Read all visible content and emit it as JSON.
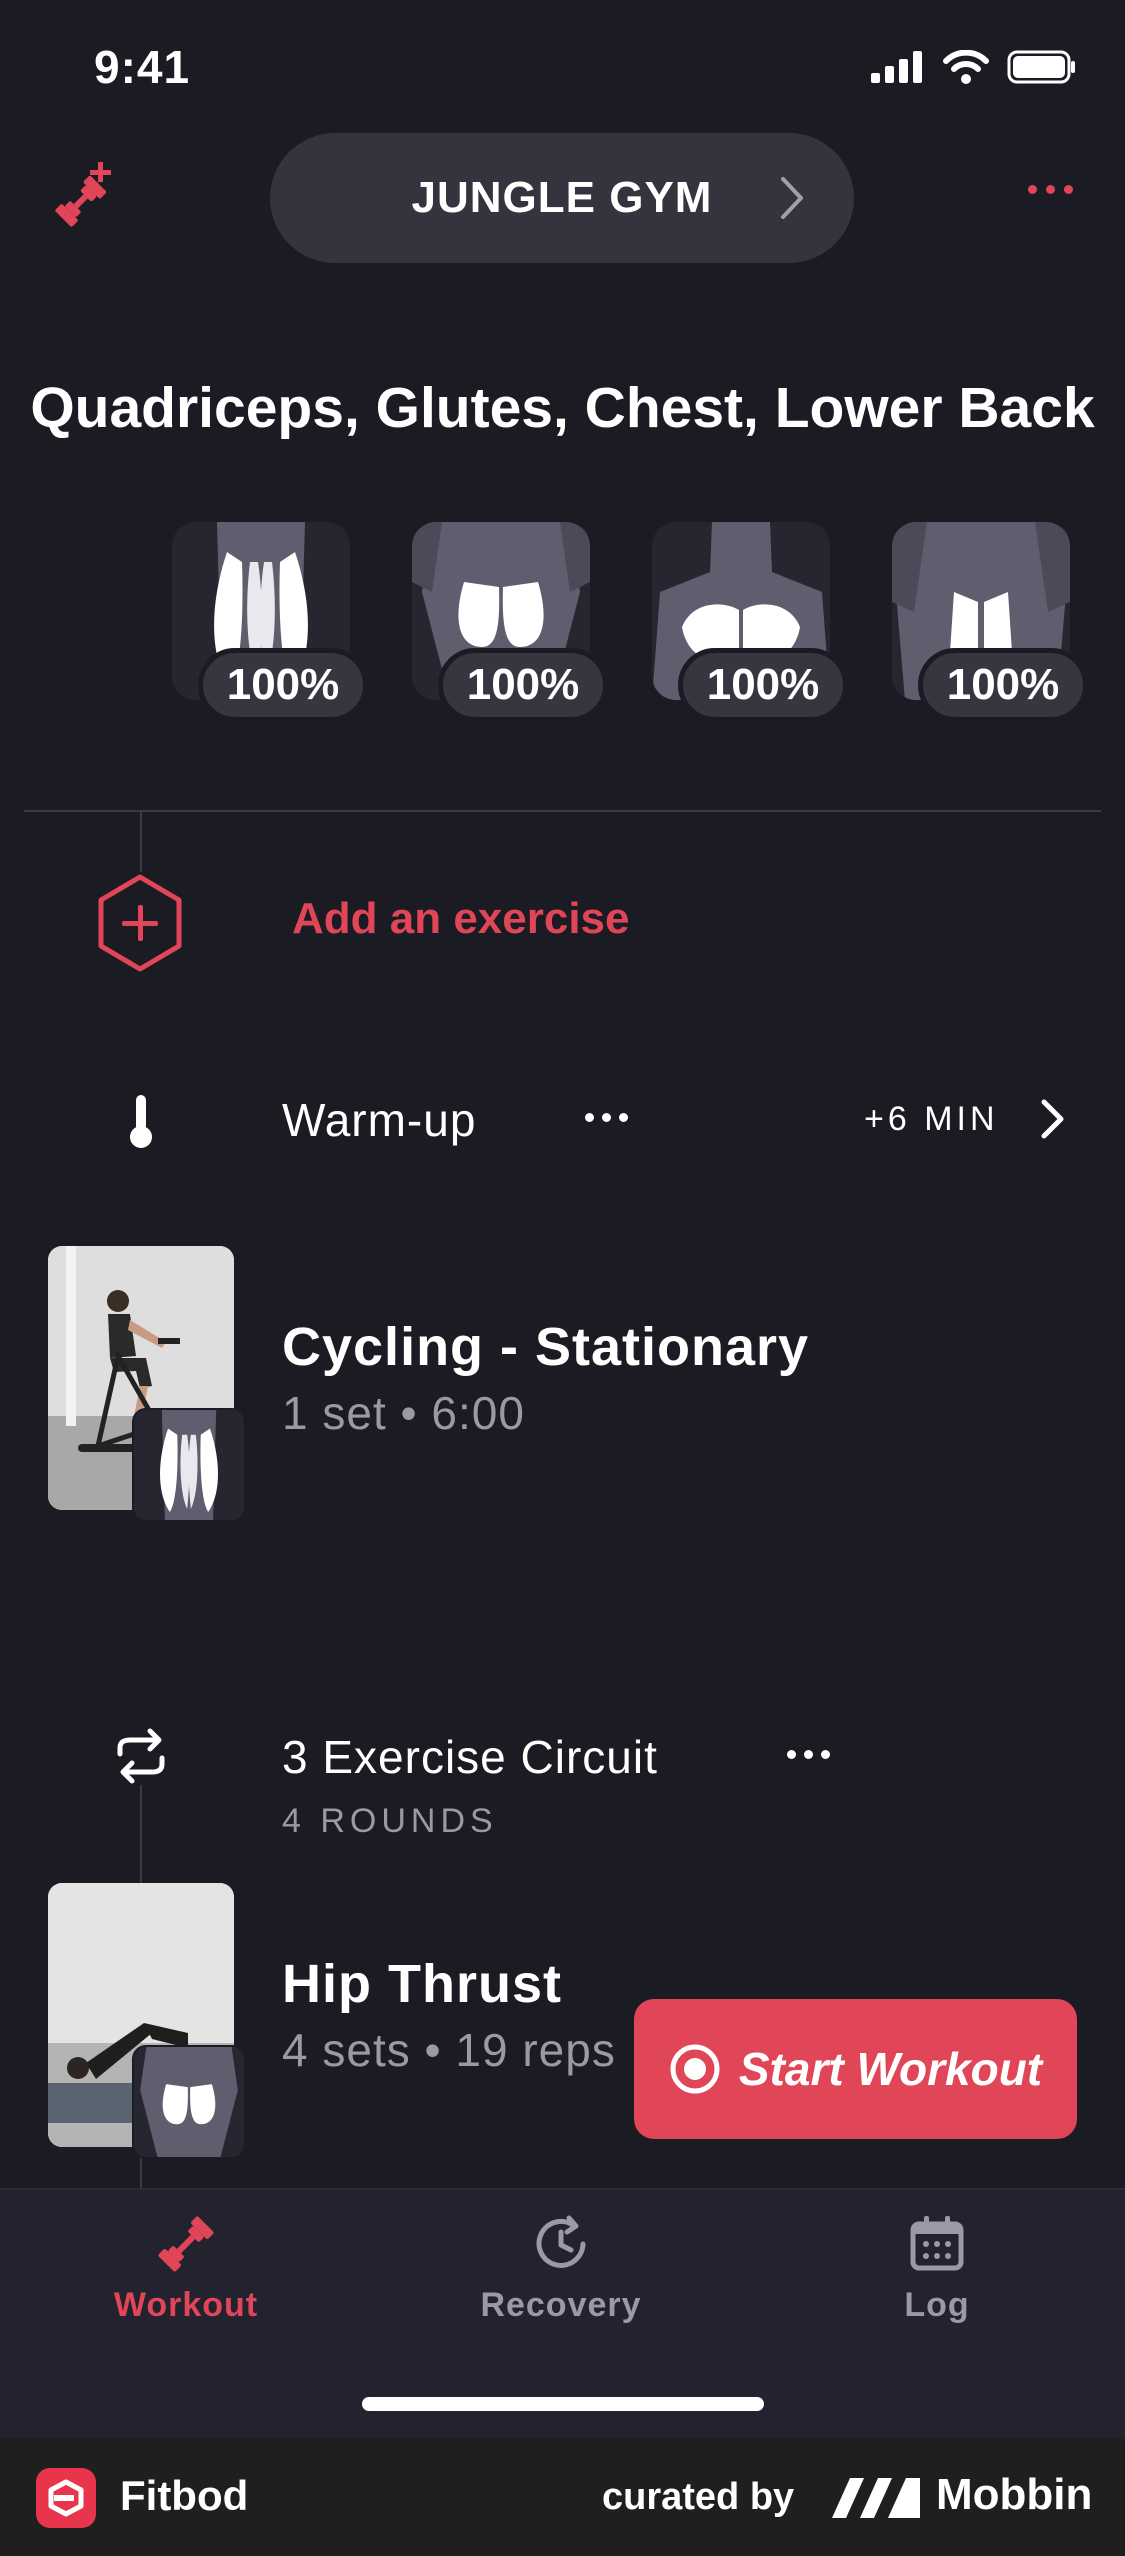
{
  "status": {
    "time": "9:41"
  },
  "header": {
    "gym_name": "JUNGLE GYM"
  },
  "muscles": {
    "title": "Quadriceps, Glutes, Chest, Lower Back",
    "items": [
      {
        "name": "quadriceps",
        "percent": "100%"
      },
      {
        "name": "glutes",
        "percent": "100%"
      },
      {
        "name": "chest",
        "percent": "100%"
      },
      {
        "name": "lower-back",
        "percent": "100%"
      }
    ]
  },
  "add_exercise": {
    "label": "Add an exercise"
  },
  "warmup": {
    "label": "Warm-up",
    "duration": "+6 MIN"
  },
  "exercises": [
    {
      "name": "Cycling - Stationary",
      "detail": "1 set • 6:00"
    },
    {
      "name": "Hip Thrust",
      "detail": "4 sets • 19 reps"
    }
  ],
  "circuit": {
    "label": "3 Exercise Circuit",
    "rounds": "4 ROUNDS"
  },
  "start_button": {
    "label": "Start Workout"
  },
  "tabs": [
    {
      "label": "Workout",
      "icon": "dumbbell-icon",
      "active": true
    },
    {
      "label": "Recovery",
      "icon": "recovery-clock-icon",
      "active": false
    },
    {
      "label": "Log",
      "icon": "calendar-icon",
      "active": false
    }
  ],
  "footer": {
    "app_name": "Fitbod",
    "curated": "curated by",
    "brand": "Mobbin"
  },
  "colors": {
    "accent": "#e04558",
    "background": "#1b1b23",
    "pill": "#34343e",
    "muted": "#9a9aa6"
  }
}
